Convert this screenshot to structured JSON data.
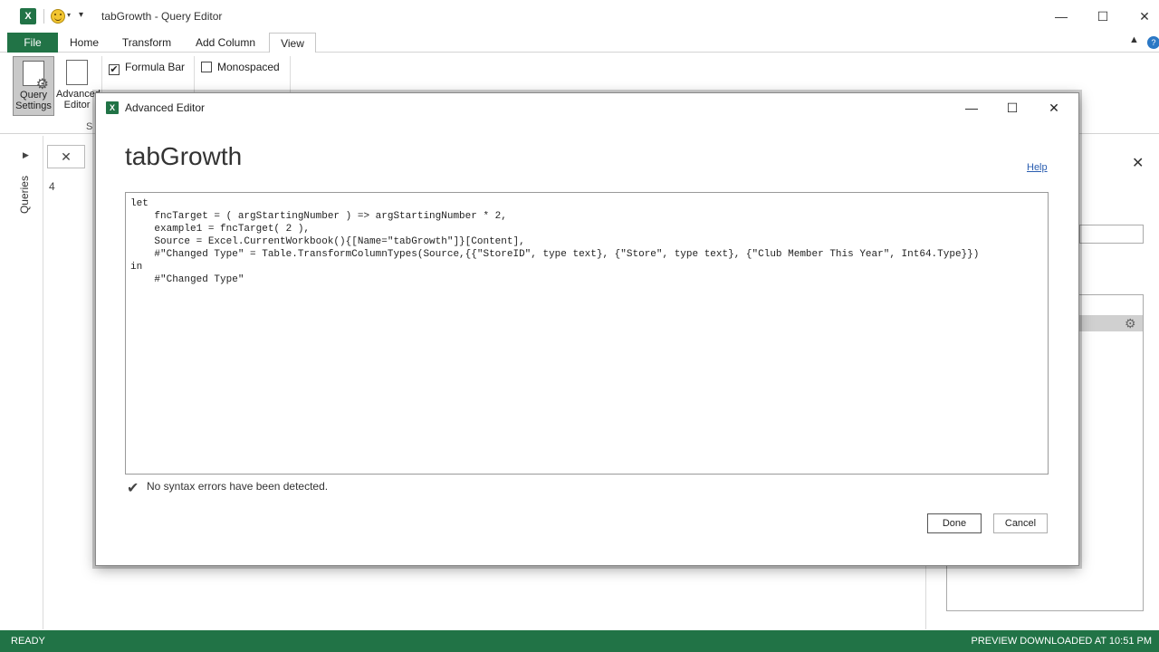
{
  "titlebar": {
    "app_icon": "X",
    "title": "tabGrowth - Query Editor",
    "qa_dropdown": "▾",
    "qa_more": "▾",
    "minimize": "—",
    "maximize": "☐",
    "close": "✕"
  },
  "ribbon_tabs": [
    {
      "label": "File"
    },
    {
      "label": "Home"
    },
    {
      "label": "Transform"
    },
    {
      "label": "Add Column"
    },
    {
      "label": "View"
    }
  ],
  "ribbon": {
    "query_settings": "Query Settings",
    "advanced_editor": "Advanced Editor",
    "formula_bar": {
      "label": "Formula Bar",
      "checked": "✔"
    },
    "monospaced": {
      "label": "Monospaced"
    },
    "group_label": "S"
  },
  "workspace": {
    "queries_label": "Queries",
    "queries_arrow": "▶",
    "formula_cancel": "✕",
    "row_number": "4",
    "settings_close": "✕"
  },
  "status": {
    "left": "READY",
    "right": "PREVIEW DOWNLOADED AT 10:51 PM"
  },
  "dialog": {
    "title": "Advanced Editor",
    "icon": "X",
    "minimize": "—",
    "maximize": "☐",
    "close": "✕",
    "query_name": "tabGrowth",
    "help": "Help",
    "code_lines": [
      "let",
      "    fncTarget = ( argStartingNumber ) => argStartingNumber * 2,",
      "    example1 = fncTarget( 2 ),",
      "    Source = Excel.CurrentWorkbook(){[Name=\"tabGrowth\"]}[Content],",
      "    #\"Changed Type\" = Table.TransformColumnTypes(Source,{{\"StoreID\", type text}, {\"Store\", type text}, {\"Club Member This Year\", Int64.Type}})",
      "in",
      "    #\"Changed Type\""
    ],
    "syntax_icon": "✔",
    "syntax_message": "No syntax errors have been detected.",
    "done": "Done",
    "cancel": "Cancel"
  },
  "colors": {
    "excel_green": "#217346",
    "link_blue": "#2a5db0"
  }
}
